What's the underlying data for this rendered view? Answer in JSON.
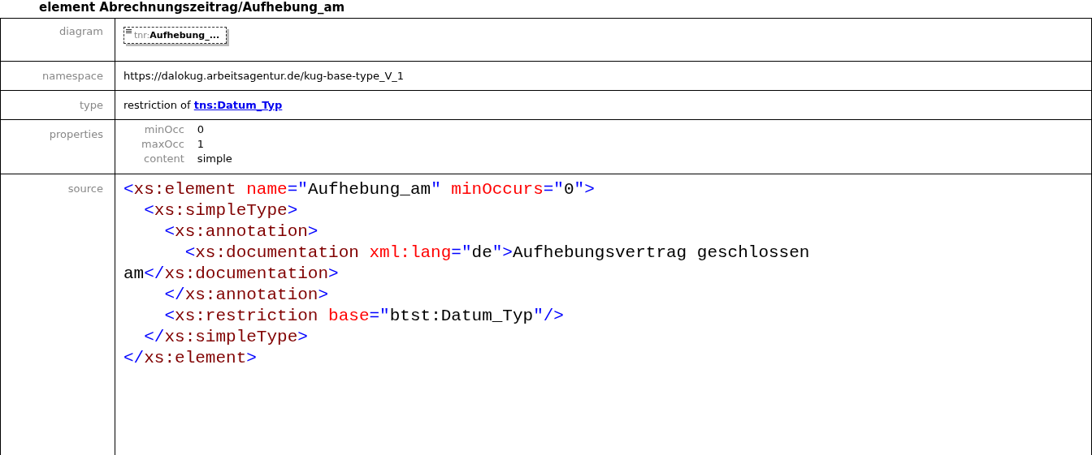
{
  "heading": "element Abrechnungszeitrag/Aufhebung_am",
  "rows": [
    {
      "kind": "diagram",
      "label": "diagram",
      "prefix": "tnr:",
      "name": "Aufhebung_..."
    },
    {
      "kind": "text",
      "label": "namespace",
      "text": "https://dalokug.arbeitsagentur.de/kug-base-type_V_1"
    },
    {
      "kind": "type",
      "label": "type",
      "text": "restriction of",
      "link": "tns:Datum_Typ"
    },
    {
      "kind": "props",
      "label": "properties",
      "props": [
        {
          "name": "minOcc",
          "value": "0"
        },
        {
          "name": "maxOcc",
          "value": "1"
        },
        {
          "name": "content",
          "value": "simple"
        }
      ]
    },
    {
      "kind": "source",
      "label": "source",
      "lines": [
        "<xs:element name=\"Aufhebung_am\" minOccurs=\"0\">",
        "  <xs:simpleType>",
        "    <xs:annotation>",
        "      <xs:documentation xml:lang=\"de\">Aufhebungsvertrag geschlossen",
        "am</xs:documentation>",
        "    </xs:annotation>",
        "    <xs:restriction base=\"btst:Datum_Typ\"/>",
        "  </xs:simpleType>",
        "</xs:element>"
      ]
    }
  ]
}
